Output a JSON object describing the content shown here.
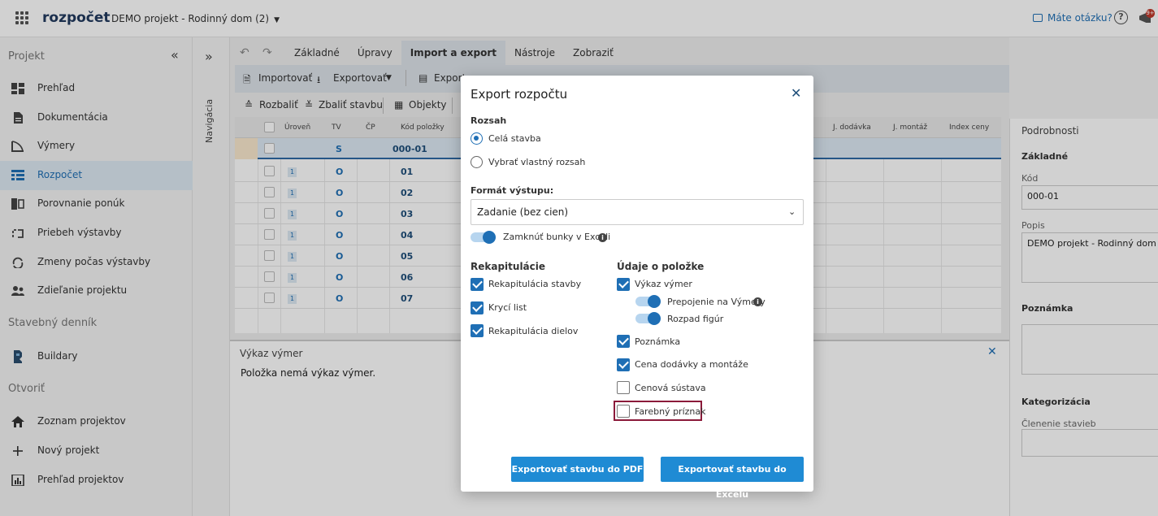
{
  "topbar": {
    "logo": "rozpočet",
    "project": "DEMO projekt - Rodinný dom (2)",
    "help": "Máte otázku?",
    "badge": "9+"
  },
  "sidebar": {
    "section_project": "Projekt",
    "items": [
      {
        "label": "Prehľad",
        "icon": "dashboard-icon"
      },
      {
        "label": "Dokumentácia",
        "icon": "document-icon"
      },
      {
        "label": "Výmery",
        "icon": "ruler-icon"
      },
      {
        "label": "Rozpočet",
        "icon": "table-icon"
      },
      {
        "label": "Porovnanie ponúk",
        "icon": "compare-icon"
      },
      {
        "label": "Priebeh výstavby",
        "icon": "progress-icon"
      },
      {
        "label": "Zmeny počas výstavby",
        "icon": "changes-icon"
      },
      {
        "label": "Zdieľanie projektu",
        "icon": "people-icon"
      }
    ],
    "section_diary": "Stavebný denník",
    "diary_item": "Buildary",
    "section_open": "Otvoriť",
    "open_items": [
      {
        "label": "Zoznam projektov",
        "icon": "home-icon"
      },
      {
        "label": "Nový projekt",
        "icon": "plus-icon"
      },
      {
        "label": "Prehľad projektov",
        "icon": "chart-icon"
      }
    ]
  },
  "nav": {
    "label": "Navigácia"
  },
  "tabs": [
    "Základné",
    "Úpravy",
    "Import a export",
    "Nástroje",
    "Zobraziť"
  ],
  "active_tab": "Import a export",
  "toolbar": {
    "import": "Importovať",
    "export": "Exportovať",
    "export2": "Export",
    "expand": "Rozbaliť",
    "collapse": "Zbaliť stavbu",
    "objects": "Objekty"
  },
  "grid": {
    "headers": [
      "Úroveň",
      "TV",
      "ČP",
      "Kód položky",
      "J. dodávka",
      "J. montáž",
      "Index ceny"
    ],
    "rows": [
      {
        "level": "",
        "tv": "S",
        "code": "000-01"
      },
      {
        "level": "1",
        "tv": "O",
        "code": "01"
      },
      {
        "level": "1",
        "tv": "O",
        "code": "02"
      },
      {
        "level": "1",
        "tv": "O",
        "code": "03"
      },
      {
        "level": "1",
        "tv": "O",
        "code": "04"
      },
      {
        "level": "1",
        "tv": "O",
        "code": "05"
      },
      {
        "level": "1",
        "tv": "O",
        "code": "06"
      },
      {
        "level": "1",
        "tv": "O",
        "code": "07"
      }
    ]
  },
  "vykaz": {
    "title": "Výkaz výmer",
    "message": "Položka nemá výkaz výmer."
  },
  "details": {
    "title": "Podrobnosti",
    "basic": "Základné",
    "code_label": "Kód",
    "code_value": "000-01",
    "desc_label": "Popis",
    "desc_value": "DEMO projekt - Rodinný dom",
    "note": "Poznámka",
    "categorization": "Kategorizácia",
    "category_label": "Členenie stavieb"
  },
  "modal": {
    "title": "Export rozpočtu",
    "range_label": "Rozsah",
    "range_whole": "Celá stavba",
    "range_custom": "Vybrať vlastný rozsah",
    "format_label": "Formát výstupu:",
    "format_value": "Zadanie (bez cien)",
    "lock_cells": "Zamknúť bunky v Exceli",
    "recap_label": "Rekapitulácie",
    "recap_items": [
      "Rekapitulácia stavby",
      "Krycí list",
      "Rekapitulácia dielov"
    ],
    "item_label": "Údaje o položke",
    "item_vykaz": "Výkaz výmer",
    "item_link": "Prepojenie na Výmery",
    "item_figures": "Rozpad figúr",
    "item_note": "Poznámka",
    "item_price": "Cena dodávky a montáže",
    "item_pricesys": "Cenová sústava",
    "item_color": "Farebný príznak",
    "btn_pdf": "Exportovať stavbu do PDF",
    "btn_excel": "Exportovať stavbu do Excelu"
  }
}
